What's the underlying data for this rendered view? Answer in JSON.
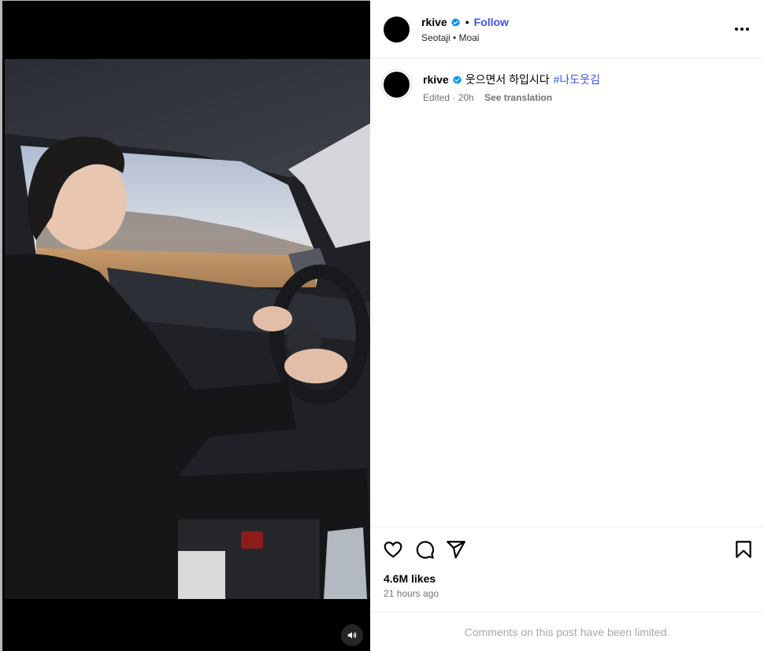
{
  "post": {
    "username": "rkive",
    "verified": true,
    "follow_label": "Follow",
    "header_separator": "•",
    "subtitle": "Seotaji • Moai"
  },
  "caption": {
    "username": "rkive",
    "text": "웃으면서 하입시다",
    "hashtag": "#나도웃김",
    "meta": "Edited · 20h",
    "see_translation": "See translation"
  },
  "actions": {
    "icons": [
      "heart-icon",
      "comment-icon",
      "share-icon",
      "bookmark-icon"
    ]
  },
  "stats": {
    "likes": "4.6M likes",
    "time_ago": "21 hours ago"
  },
  "footer": {
    "comments_notice": "Comments on this post have been limited."
  },
  "colors": {
    "accent": "#4150f7",
    "verified": "#0095f6",
    "muted": "#737373",
    "divider": "#efefef"
  }
}
